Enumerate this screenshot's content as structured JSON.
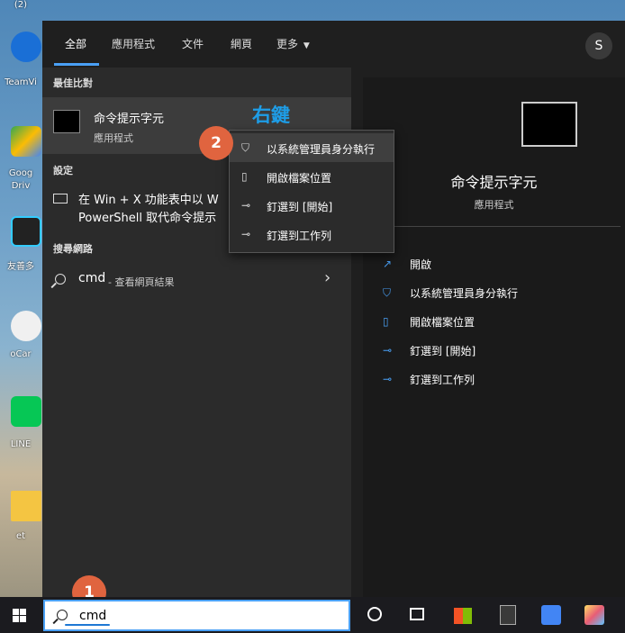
{
  "desktop": {
    "icons": [
      {
        "label": "(2)"
      },
      {
        "label": "TeamVi"
      },
      {
        "label": "Goog\nDriv"
      },
      {
        "label": "友善多"
      },
      {
        "label": "oCar"
      },
      {
        "label": "LINE"
      },
      {
        "label": "et"
      }
    ]
  },
  "start_menu": {
    "tabs": [
      {
        "label": "全部",
        "active": true
      },
      {
        "label": "應用程式"
      },
      {
        "label": "文件"
      },
      {
        "label": "網頁"
      },
      {
        "label": "更多"
      }
    ],
    "avatar": "S",
    "best_match": {
      "title": "最佳比對",
      "name": "命令提示字元",
      "type": "應用程式"
    },
    "hint": "右鍵",
    "settings": {
      "title": "設定",
      "item": "在 Win + X 功能表中以 W\nPowerShell 取代命令提示"
    },
    "web": {
      "title": "搜尋網路",
      "query": "cmd",
      "desc": "- 查看網頁結果"
    },
    "detail": {
      "name": "命令提示字元",
      "type": "應用程式",
      "actions": [
        {
          "label": "開啟",
          "icon": "open-icon"
        },
        {
          "label": "以系統管理員身分執行",
          "icon": "shield-icon"
        },
        {
          "label": "開啟檔案位置",
          "icon": "folder-icon"
        },
        {
          "label": "釘選到 [開始]",
          "icon": "pin-icon"
        },
        {
          "label": "釘選到工作列",
          "icon": "pin-icon"
        }
      ]
    }
  },
  "context_menu": {
    "items": [
      {
        "label": "以系統管理員身分執行",
        "icon": "shield-icon"
      },
      {
        "label": "開啟檔案位置",
        "icon": "folder-icon"
      },
      {
        "label": "釘選到 [開始]",
        "icon": "pin-icon"
      },
      {
        "label": "釘選到工作列",
        "icon": "pin-icon"
      }
    ]
  },
  "badges": {
    "step1": "1",
    "step2": "2"
  },
  "taskbar": {
    "search_value": "cmd"
  },
  "colors": {
    "accent": "#4aa0f5",
    "badge": "#e0643f",
    "hint": "#1e9ee8"
  }
}
